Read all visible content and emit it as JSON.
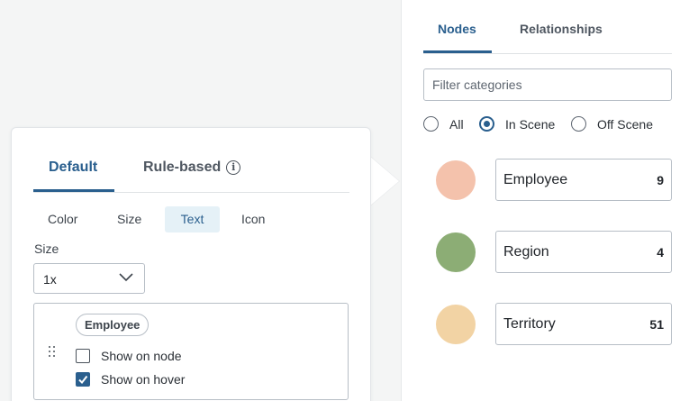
{
  "right_panel": {
    "tabs": [
      {
        "label": "Nodes",
        "active": true
      },
      {
        "label": "Relationships",
        "active": false
      }
    ],
    "filter": {
      "placeholder": "Filter categories",
      "value": ""
    },
    "scope_options": [
      {
        "label": "All",
        "selected": false
      },
      {
        "label": "In Scene",
        "selected": true
      },
      {
        "label": "Off Scene",
        "selected": false
      }
    ],
    "categories": [
      {
        "name": "Employee",
        "count": "9",
        "color": "#f4c2ac"
      },
      {
        "name": "Region",
        "count": "4",
        "color": "#8cad75"
      },
      {
        "name": "Territory",
        "count": "51",
        "color": "#f2d3a4"
      }
    ]
  },
  "card": {
    "tabs": [
      {
        "label": "Default",
        "active": true
      },
      {
        "label": "Rule-based",
        "active": false,
        "icon": "info-icon"
      }
    ],
    "style_tabs": [
      {
        "label": "Color",
        "active": false
      },
      {
        "label": "Size",
        "active": false
      },
      {
        "label": "Text",
        "active": true
      },
      {
        "label": "Icon",
        "active": false
      }
    ],
    "size_label": "Size",
    "size_value": "1x",
    "property": {
      "chip": "Employee",
      "show_on_node": {
        "label": "Show on node",
        "checked": false
      },
      "show_on_hover": {
        "label": "Show on hover",
        "checked": true
      }
    }
  },
  "colors": {
    "accent": "#2a5f8e",
    "active_subtab_bg": "#e5f1f7"
  }
}
